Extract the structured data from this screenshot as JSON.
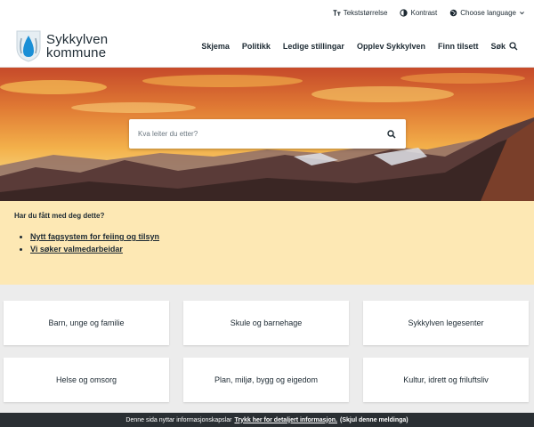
{
  "utility": {
    "text_size": "Tekststørrelse",
    "contrast": "Kontrast",
    "language": "Choose language"
  },
  "header": {
    "logo_line1": "Sykkylven",
    "logo_line2": "kommune",
    "nav": [
      "Skjema",
      "Politikk",
      "Ledige stillingar",
      "Opplev Sykkylven",
      "Finn tilsett",
      "Søk"
    ]
  },
  "search": {
    "placeholder": "Kva leiter du etter?"
  },
  "notice": {
    "title": "Har du fått med deg dette?",
    "links": [
      "Nytt fagsystem for feiing og tilsyn",
      "Vi søker valmedarbeidar"
    ]
  },
  "tiles": [
    "Barn, unge og familie",
    "Skule og barnehage",
    "Sykkylven legesenter",
    "Helse og omsorg",
    "Plan, miljø, bygg og eigedom",
    "Kultur, idrett og friluftsliv"
  ],
  "cookie": {
    "text": "Denne sida nyttar informasjonskapslar",
    "link": "Trykk her for detaljert informasjon.",
    "dismiss": "(Skjul denne meldinga)"
  },
  "colors": {
    "accent_blue": "#1a8fd6",
    "notice_bg": "#fde8b4",
    "cookie_bg": "#2a2f33"
  }
}
